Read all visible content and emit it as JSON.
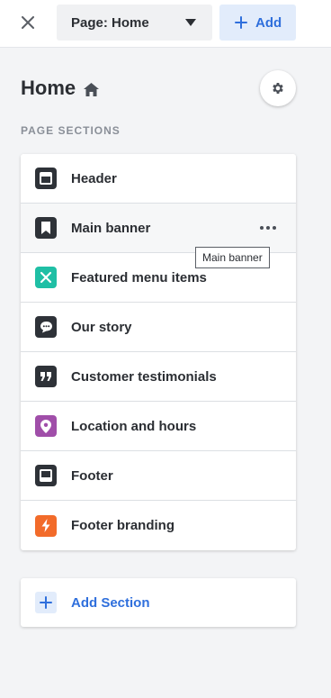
{
  "topbar": {
    "close_icon": "close-icon",
    "page_select": {
      "value": "Page: Home",
      "icon": "caret-down-icon"
    },
    "add_button": {
      "label": "Add",
      "icon": "plus-icon"
    }
  },
  "header": {
    "title": "Home",
    "title_icon": "home-icon",
    "settings_icon": "gear-icon"
  },
  "sections_label": "PAGE SECTIONS",
  "sections": [
    {
      "label": "Header",
      "icon": "header-layout-icon",
      "color": "#2e3238"
    },
    {
      "label": "Main banner",
      "icon": "bookmark-icon",
      "color": "#2e3238",
      "hovered": true
    },
    {
      "label": "Featured menu items",
      "icon": "utensils-icon",
      "color": "#1fbfa5"
    },
    {
      "label": "Our story",
      "icon": "chat-bubble-icon",
      "color": "#2e3238"
    },
    {
      "label": "Customer testimonials",
      "icon": "quote-icon",
      "color": "#2e3238"
    },
    {
      "label": "Location and hours",
      "icon": "map-pin-icon",
      "color": "#a04ea9"
    },
    {
      "label": "Footer",
      "icon": "footer-layout-icon",
      "color": "#2e3238"
    },
    {
      "label": "Footer branding",
      "icon": "lightning-icon",
      "color": "#f26b2a"
    }
  ],
  "tooltip": "Main banner",
  "add_section": {
    "label": "Add Section",
    "icon": "plus-icon"
  },
  "colors": {
    "accent": "#2f6fdc",
    "accent_bg": "#e2ecfb",
    "background": "#f3f4f6"
  }
}
